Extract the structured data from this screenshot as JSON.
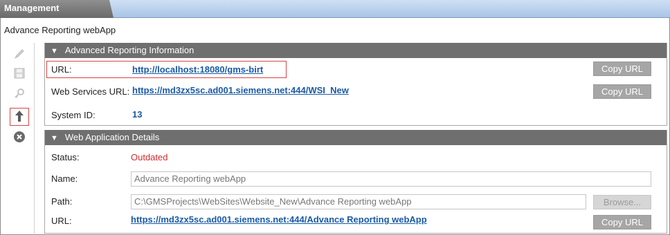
{
  "tab": {
    "title": "Management"
  },
  "page": {
    "subtitle": "Advance Reporting webApp"
  },
  "toolbar": {
    "icons": [
      "pencil-icon",
      "save-icon",
      "search-key-icon",
      "upload-arrow-icon",
      "close-circle-icon"
    ]
  },
  "reporting": {
    "header": "Advanced Reporting Information",
    "url_label": "URL:",
    "url_value": "http://localhost:18080/gms-birt",
    "ws_label": "Web Services URL:",
    "ws_value": "https://md3zx5sc.ad001.siemens.net:444/WSI_New",
    "sysid_label": "System ID:",
    "sysid_value": "13",
    "copy_label": "Copy URL"
  },
  "webapp": {
    "header": "Web Application Details",
    "status_label": "Status:",
    "status_value": "Outdated",
    "name_label": "Name:",
    "name_value": "Advance Reporting webApp",
    "path_label": "Path:",
    "path_value": "C:\\GMSProjects\\WebSites\\Website_New\\Advance Reporting webApp",
    "browse_label": "Browse...",
    "url_label": "URL:",
    "url_value": "https://md3zx5sc.ad001.siemens.net:444/Advance Reporting webApp",
    "copy_label": "Copy URL"
  },
  "colors": {
    "header_bg": "#6f6f6f",
    "link": "#1a5aa6",
    "status_outdated": "#d12b2b",
    "highlight": "#d64545"
  }
}
